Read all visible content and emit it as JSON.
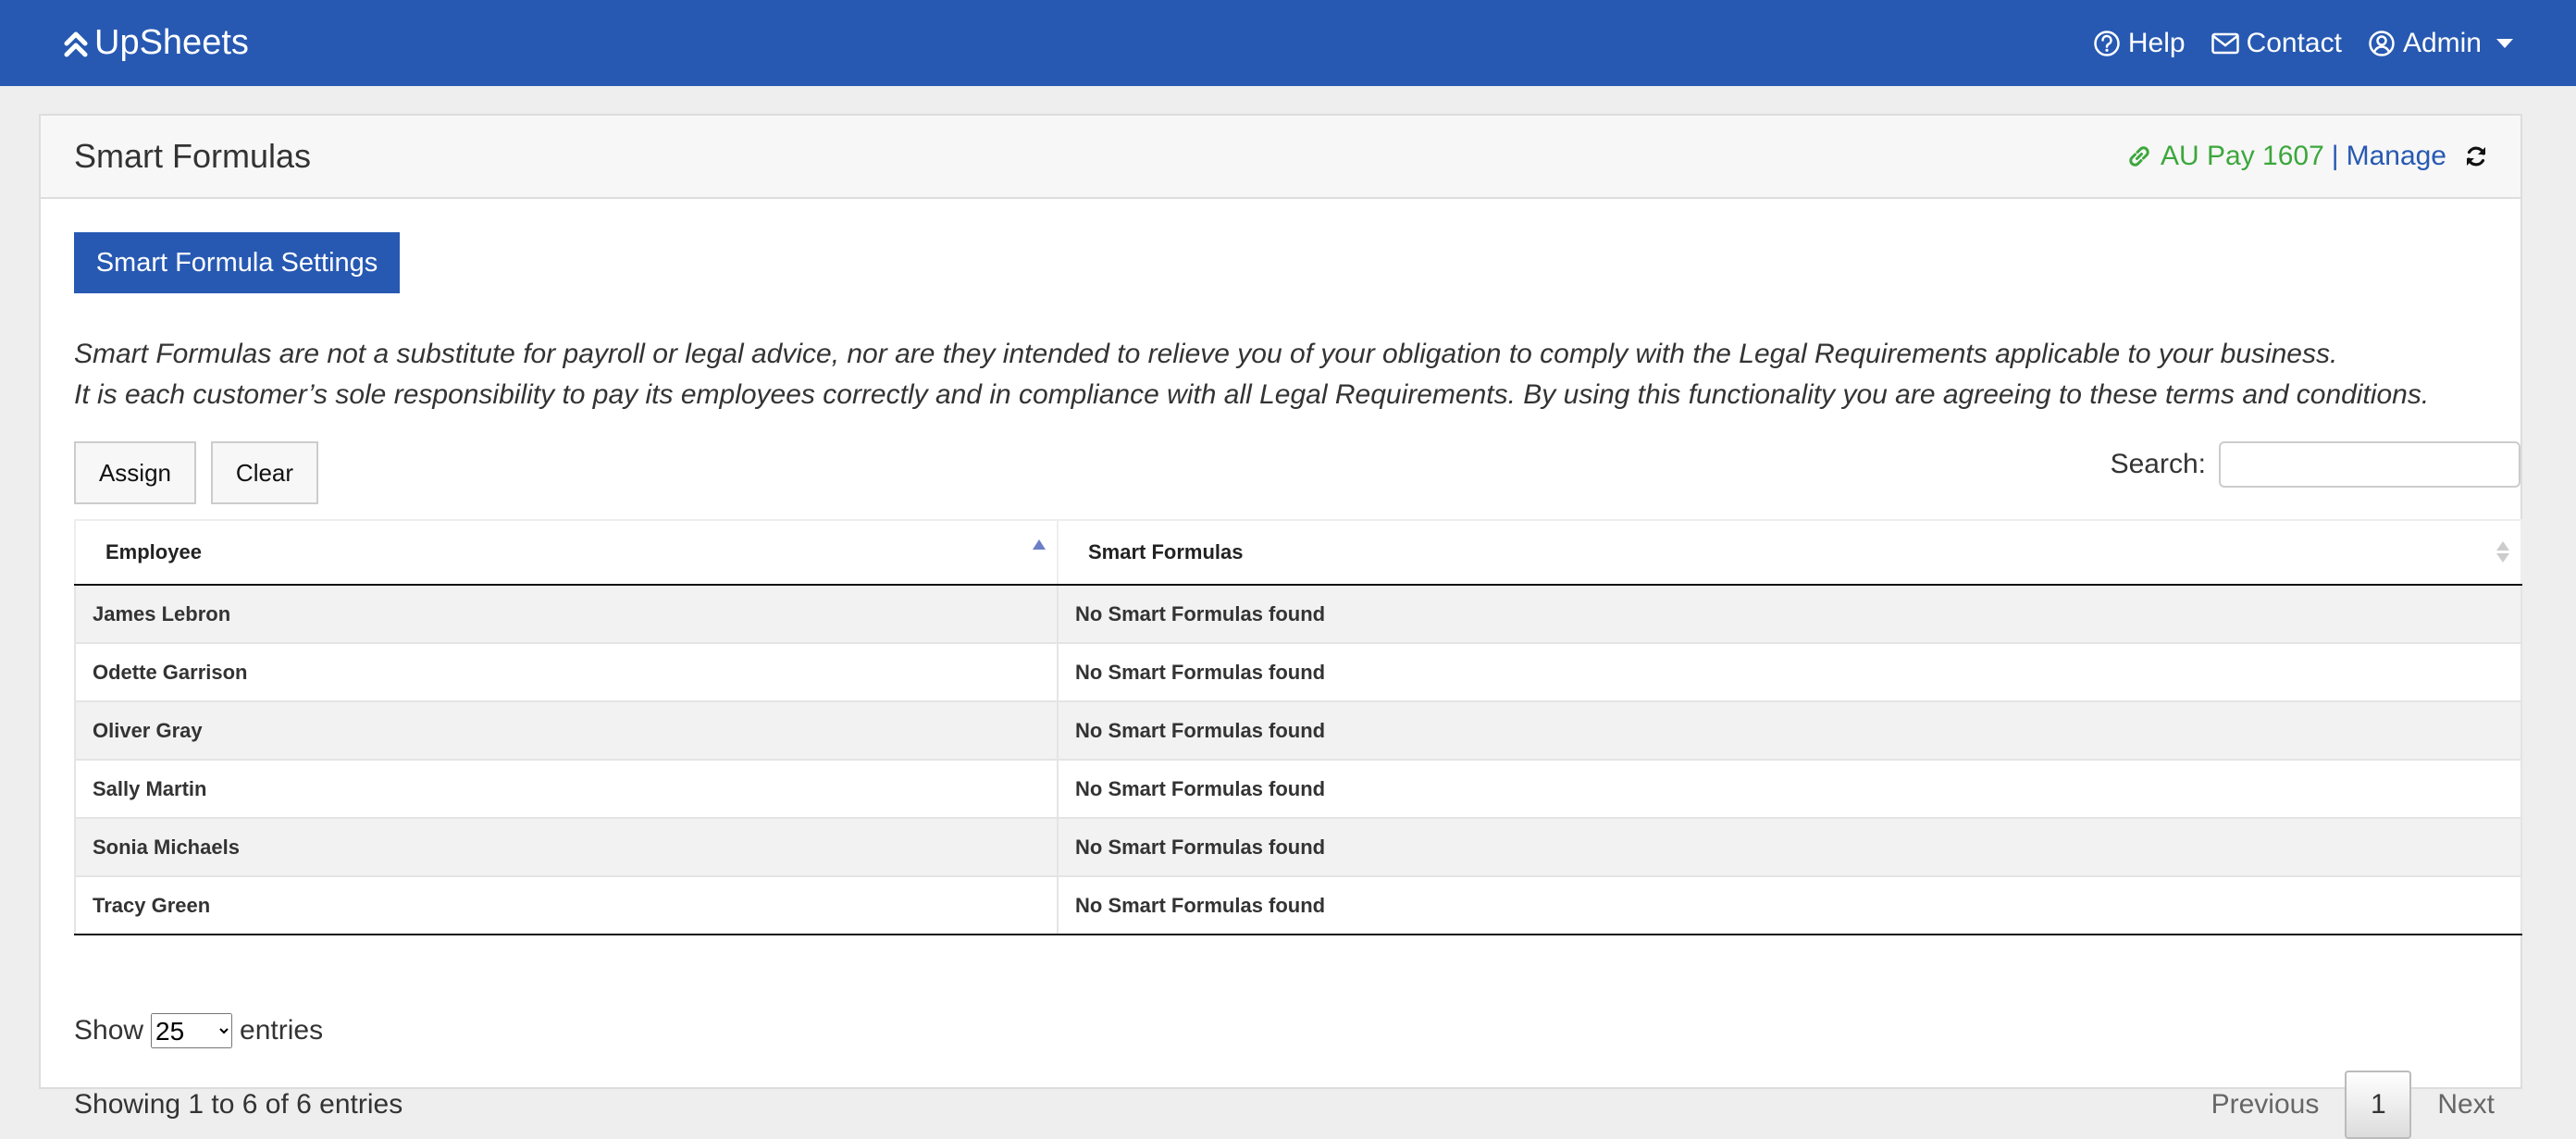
{
  "navbar": {
    "brand": "UpSheets",
    "help": "Help",
    "contact": "Contact",
    "admin": "Admin",
    "bg_color": "#2759b2"
  },
  "header": {
    "title": "Smart Formulas",
    "link_label": "AU Pay 1607",
    "separator": "|",
    "manage": "Manage"
  },
  "actions": {
    "settings_button": "Smart Formula Settings",
    "assign": "Assign",
    "clear": "Clear"
  },
  "disclaimer": {
    "line1": "Smart Formulas are not a substitute for payroll or legal advice, nor are they intended to relieve you of your obligation to comply with the Legal Requirements applicable to your business.",
    "line2": "It is each customer’s sole responsibility to pay its employees correctly and in compliance with all Legal Requirements. By using this functionality you are agreeing to these terms and conditions."
  },
  "search": {
    "label": "Search:",
    "value": ""
  },
  "table": {
    "columns": [
      "Employee",
      "Smart Formulas"
    ],
    "rows": [
      {
        "employee": "James Lebron",
        "formulas": "No Smart Formulas found"
      },
      {
        "employee": "Odette Garrison",
        "formulas": "No Smart Formulas found"
      },
      {
        "employee": "Oliver Gray",
        "formulas": "No Smart Formulas found"
      },
      {
        "employee": "Sally Martin",
        "formulas": "No Smart Formulas found"
      },
      {
        "employee": "Sonia Michaels",
        "formulas": "No Smart Formulas found"
      },
      {
        "employee": "Tracy Green",
        "formulas": "No Smart Formulas found"
      }
    ]
  },
  "footer": {
    "show": "Show",
    "entries_value": "25",
    "entries": "entries",
    "info": "Showing 1 to 6 of 6 entries",
    "previous": "Previous",
    "current_page": "1",
    "next": "Next"
  },
  "icons": {
    "brand": "chevrons-up-icon",
    "help": "question-circle-icon",
    "contact": "envelope-icon",
    "admin": "user-circle-icon",
    "link": "link-icon",
    "refresh": "refresh-icon"
  }
}
